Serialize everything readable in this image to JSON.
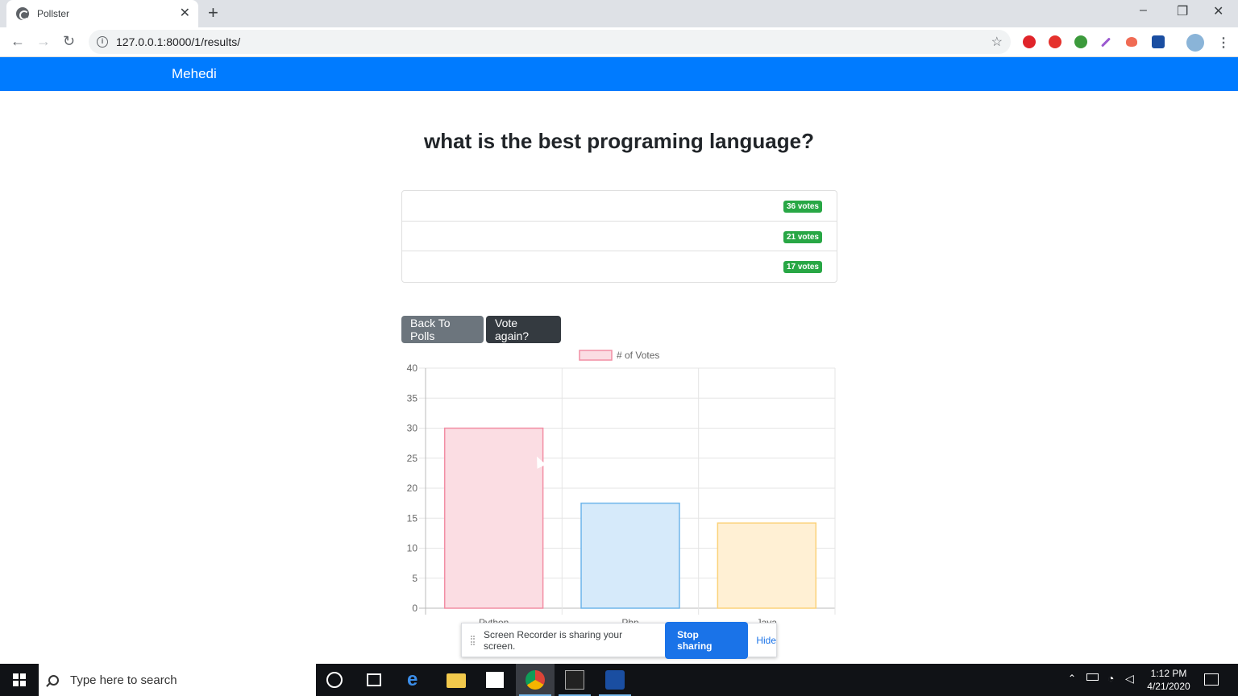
{
  "browser": {
    "tab_title": "Pollster",
    "tab_close": "✕",
    "new_tab": "+",
    "url": "127.0.0.1:8000/1/results/",
    "window_controls": {
      "minimize": "–",
      "restore": "❐",
      "close": "✕"
    }
  },
  "app": {
    "brand": "Mehedi",
    "question": "what is the best programing language?",
    "results": [
      {
        "badge": "36 votes"
      },
      {
        "badge": "21 votes"
      },
      {
        "badge": "17 votes"
      }
    ],
    "back_button": "Back To Polls",
    "vote_button": "Vote again?"
  },
  "chart_data": {
    "type": "bar",
    "categories": [
      "Python",
      "Php",
      "Java"
    ],
    "series": [
      {
        "name": "# of Votes",
        "values": [
          30,
          17.5,
          14.2
        ]
      }
    ],
    "ylim": [
      0,
      40
    ],
    "yticks": [
      0,
      5,
      10,
      15,
      20,
      25,
      30,
      35,
      40
    ],
    "grid": true,
    "legend": "top",
    "fills": [
      "#fbdde3",
      "#d6eafa",
      "#fff0d4"
    ],
    "strokes": [
      "#f28ea4",
      "#6fb5ea",
      "#fbd27a"
    ]
  },
  "share_bar": {
    "text": "Screen Recorder is sharing your screen.",
    "stop": "Stop sharing",
    "hide": "Hide"
  },
  "taskbar": {
    "search_placeholder": "Type here to search",
    "time": "1:12 PM",
    "date": "4/21/2020"
  }
}
